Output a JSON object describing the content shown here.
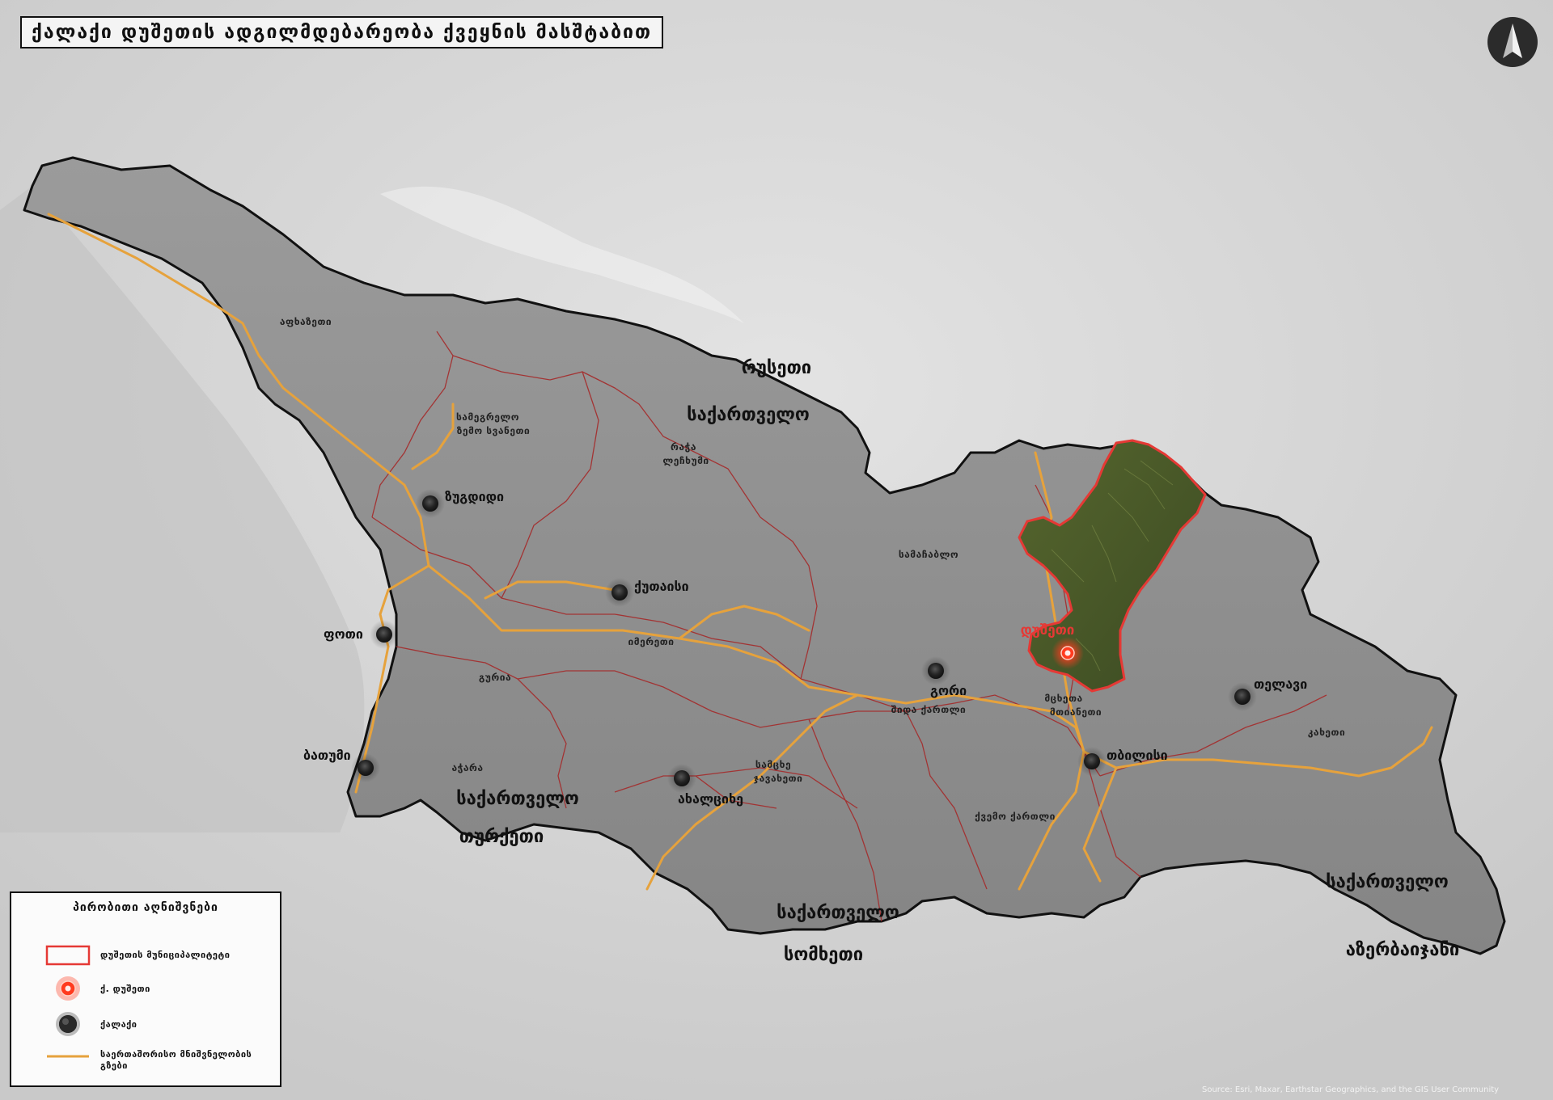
{
  "title": "ქალაქი დუშეთის ადგილმდებარეობა ქვეყნის მასშტაბით",
  "north_arrow": {
    "icon": "north-arrow-icon"
  },
  "countries": {
    "russia": "რუსეთი",
    "turkey": "თურქეთი",
    "armenia": "სომხეთი",
    "azerbaijan": "აზერბაიჯანი",
    "georgia_north": "საქართველო",
    "georgia_sw": "საქართველო",
    "georgia_south": "საქართველო",
    "georgia_se": "საქართველო"
  },
  "regions": {
    "abkhazia": "აფხაზეთი",
    "samegrelo_1": "სამეგრელო",
    "samegrelo_2": "ზემო სვანეთი",
    "racha_1": "რაჭა",
    "racha_2": "ლეჩხუმი",
    "samachablo": "სამაჩაბლო",
    "imereti": "იმერეთი",
    "guria": "გურია",
    "ajara": "აჭარა",
    "samtskhe_1": "სამცხე",
    "samtskhe_2": "ჯავახეთი",
    "shida_kartli": "შიდა ქართლი",
    "mtskheta_1": "მცხეთა",
    "mtskheta_2": "მთიანეთი",
    "kvemo_kartli": "ქვემო ქართლი",
    "kakheti": "კახეთი"
  },
  "cities": {
    "zugdidi": "ზუგდიდი",
    "kutaisi": "ქუთაისი",
    "poti": "ფოთი",
    "batumi": "ბათუმი",
    "akhaltsikhe": "ახალციხე",
    "gori": "გორი",
    "tbilisi": "თბილისი",
    "telavi": "თელავი",
    "dusheti": "დუშეთი"
  },
  "legend": {
    "title": "პირობითი აღნიშვნები",
    "items": [
      {
        "label": "დუშეთის მუნიციპალიტეტი",
        "symbol": "red-outline-rectangle"
      },
      {
        "label": "ქ. დუშეთი",
        "symbol": "red-glow-circle"
      },
      {
        "label": "ქალაქი",
        "symbol": "dark-circle"
      },
      {
        "label": "საერთაშორისო მნიშვნელობის გზები",
        "symbol": "orange-line"
      }
    ]
  },
  "attribution": "Source: Esri, Maxar, Earthstar Geographics, and the GIS User Community",
  "colors": {
    "country_fill": "#8f8f8f",
    "country_border": "#111111",
    "region_border": "#a52a2a",
    "road": "#e6a23c",
    "municipality_border": "#e53935",
    "municipality_fill": "#4d5a2c",
    "city_dot": "#2a2a2a",
    "dusheti_dot": "#ff3b1f"
  }
}
